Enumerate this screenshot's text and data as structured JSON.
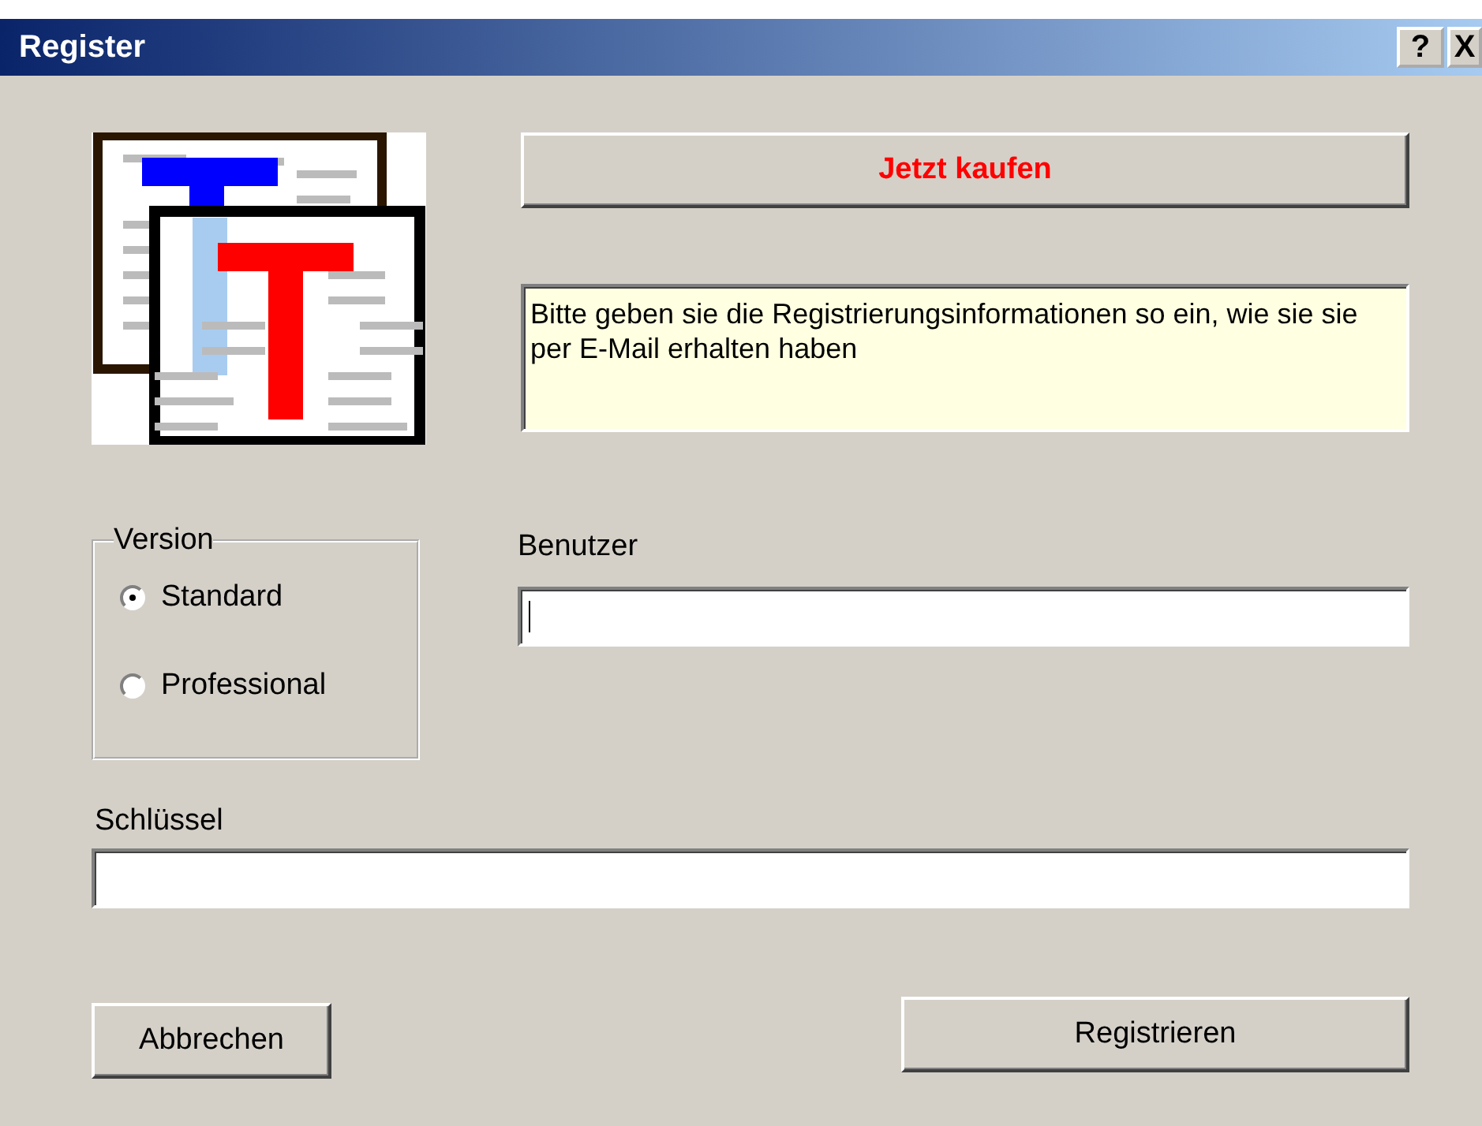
{
  "window": {
    "title": "Register",
    "controls": [
      {
        "kind": "help",
        "label": "?"
      },
      {
        "kind": "close",
        "label": "X"
      }
    ]
  },
  "buy_button": {
    "label": "Jetzt kaufen"
  },
  "info": {
    "text": "Bitte geben sie die Registrierungsinformationen so ein, wie sie sie per E-Mail erhalten haben"
  },
  "version": {
    "title": "Version",
    "options": [
      {
        "label": "Standard",
        "selected": true
      },
      {
        "label": "Professional",
        "selected": false
      }
    ]
  },
  "user": {
    "label": "Benutzer",
    "focused": true
  },
  "key": {
    "label": "Schlüssel"
  },
  "buttons": [
    {
      "kind": "cancel",
      "label": "Abbrechen"
    },
    {
      "kind": "submit",
      "label": "Registrieren"
    }
  ]
}
